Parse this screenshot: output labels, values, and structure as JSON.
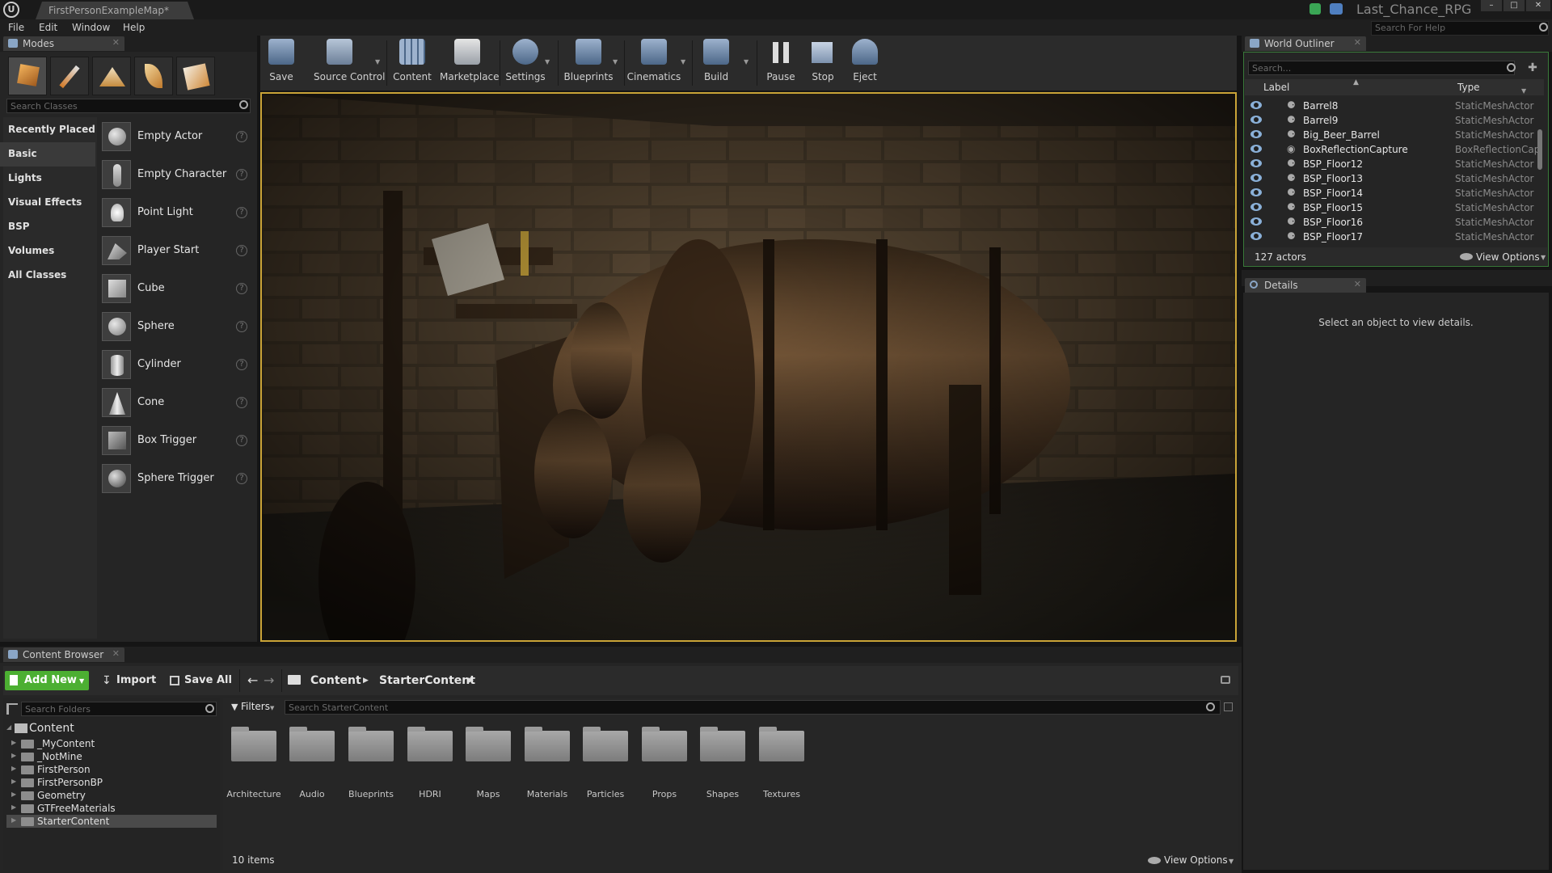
{
  "window": {
    "document_tab": "FirstPersonExampleMap*",
    "project_name": "Last_Chance_RPG",
    "help_search_placeholder": "Search For Help"
  },
  "menu": [
    "File",
    "Edit",
    "Window",
    "Help"
  ],
  "modes_panel": {
    "tab_label": "Modes",
    "search_placeholder": "Search Classes",
    "categories": [
      "Recently Placed",
      "Basic",
      "Lights",
      "Visual Effects",
      "BSP",
      "Volumes",
      "All Classes"
    ],
    "active_category": "Basic",
    "items": [
      "Empty Actor",
      "Empty Character",
      "Point Light",
      "Player Start",
      "Cube",
      "Sphere",
      "Cylinder",
      "Cone",
      "Box Trigger",
      "Sphere Trigger"
    ]
  },
  "toolbar": {
    "buttons": [
      "Save",
      "Source Control",
      "Content",
      "Marketplace",
      "Settings",
      "Blueprints",
      "Cinematics",
      "Build",
      "Pause",
      "Stop",
      "Eject"
    ]
  },
  "world_outliner": {
    "tab_label": "World Outliner",
    "search_placeholder": "Search...",
    "col_label": "Label",
    "col_type": "Type",
    "rows": [
      {
        "label": "Barrel8",
        "type": "StaticMeshActor"
      },
      {
        "label": "Barrel9",
        "type": "StaticMeshActor"
      },
      {
        "label": "Big_Beer_Barrel",
        "type": "StaticMeshActor"
      },
      {
        "label": "BoxReflectionCapture",
        "type": "BoxReflectionCap"
      },
      {
        "label": "BSP_Floor12",
        "type": "StaticMeshActor"
      },
      {
        "label": "BSP_Floor13",
        "type": "StaticMeshActor"
      },
      {
        "label": "BSP_Floor14",
        "type": "StaticMeshActor"
      },
      {
        "label": "BSP_Floor15",
        "type": "StaticMeshActor"
      },
      {
        "label": "BSP_Floor16",
        "type": "StaticMeshActor"
      },
      {
        "label": "BSP_Floor17",
        "type": "StaticMeshActor"
      }
    ],
    "actor_count": "127 actors",
    "view_options": "View Options"
  },
  "details_panel": {
    "tab_label": "Details",
    "empty_message": "Select an object to view details."
  },
  "content_browser": {
    "tab_label": "Content Browser",
    "add_new": "Add New",
    "import": "Import",
    "save_all": "Save All",
    "path": [
      "Content",
      "StarterContent"
    ],
    "folder_search_placeholder": "Search Folders",
    "filters_label": "Filters",
    "asset_search_placeholder": "Search StarterContent",
    "tree_root": "Content",
    "tree": [
      "_MyContent",
      "_NotMine",
      "FirstPerson",
      "FirstPersonBP",
      "Geometry",
      "GTFreeMaterials",
      "StarterContent"
    ],
    "selected_tree_item": "StarterContent",
    "folders": [
      "Architecture",
      "Audio",
      "Blueprints",
      "HDRI",
      "Maps",
      "Materials",
      "Particles",
      "Props",
      "Shapes",
      "Textures"
    ],
    "item_count": "10 items",
    "view_options": "View Options"
  },
  "colors": {
    "viewport_border": "#c9a337",
    "add_new_green": "#4caf32",
    "panel_bg": "#252525"
  }
}
